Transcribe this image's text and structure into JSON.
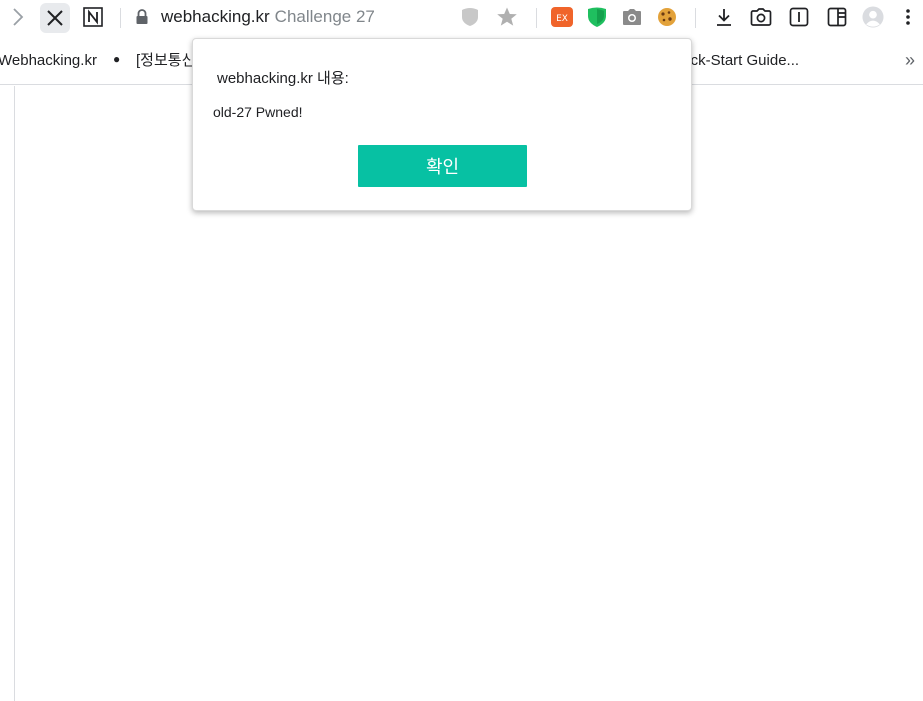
{
  "toolbar": {
    "url_host": "webhacking.kr",
    "page_title": "Challenge 27",
    "icons": [
      "chevron-right-icon",
      "close-icon",
      "notion-icon",
      "lock-icon",
      "shield-icon",
      "star-icon",
      "ex-extension-icon",
      "green-shield-icon",
      "camera-icon",
      "cookie-icon",
      "download-icon",
      "screenshot-icon",
      "reader-icon",
      "sidebar-icon",
      "profile-icon",
      "more-icon"
    ]
  },
  "bookmarks": {
    "items": [
      {
        "label": "Webhacking.kr"
      },
      {
        "label": "[정보통신"
      },
      {
        "label": "uick-Start Guide..."
      }
    ],
    "more_label": "»"
  },
  "dialog": {
    "title": "webhacking.kr 내용:",
    "message": "old-27 Pwned!",
    "ok_label": "확인"
  },
  "colors": {
    "ok_button": "#07c1a3",
    "ex_extension": "#f0642a",
    "green_shield": "#1fbf5f"
  }
}
